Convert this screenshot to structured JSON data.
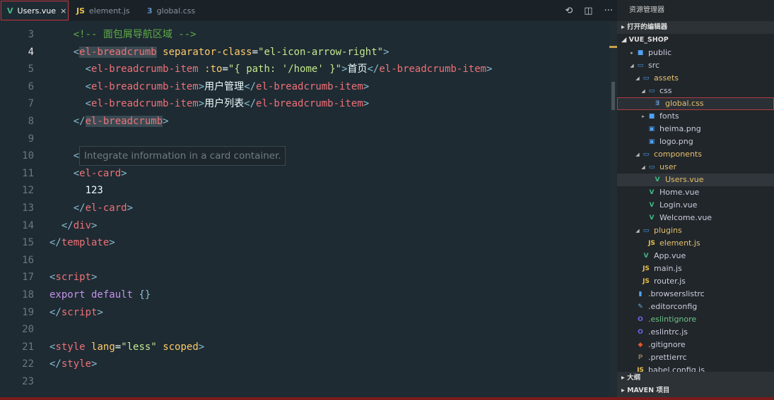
{
  "tabs": [
    {
      "label": "Users.vue",
      "icon": "V",
      "icon_color": "#41b883",
      "active": true
    },
    {
      "label": "element.js",
      "icon": "JS",
      "icon_color": "#e8c04a"
    },
    {
      "label": "global.css",
      "icon": "3",
      "icon_color": "#5d8fc4"
    }
  ],
  "actions": {
    "compare": "⟲",
    "split": "◫",
    "more": "···"
  },
  "editor": {
    "current_line": 4,
    "lines": [
      {
        "n": 3,
        "indent": 4,
        "tokens": [
          [
            "cm",
            "<!-- 面包屑导航区域 -->"
          ]
        ]
      },
      {
        "n": 4,
        "indent": 4,
        "tokens": [
          [
            "p",
            "<"
          ],
          [
            "tag hl",
            "el-breadcrumb"
          ],
          [
            "txt",
            " "
          ],
          [
            "attr",
            "separator-class"
          ],
          [
            "txt",
            "="
          ],
          [
            "str",
            "\"el-icon-arrow-right\""
          ],
          [
            "p",
            ">"
          ]
        ]
      },
      {
        "n": 5,
        "indent": 6,
        "tokens": [
          [
            "p",
            "<"
          ],
          [
            "tag",
            "el-breadcrumb-item"
          ],
          [
            "txt",
            " "
          ],
          [
            "attr",
            ":to"
          ],
          [
            "txt",
            "="
          ],
          [
            "str",
            "\"{ path: '/home' }\""
          ],
          [
            "p",
            ">"
          ],
          [
            "txt",
            "首页"
          ],
          [
            "p",
            "</"
          ],
          [
            "tag",
            "el-breadcrumb-item"
          ],
          [
            "p",
            ">"
          ]
        ]
      },
      {
        "n": 6,
        "indent": 6,
        "tokens": [
          [
            "p",
            "<"
          ],
          [
            "tag",
            "el-breadcrumb-item"
          ],
          [
            "p",
            ">"
          ],
          [
            "txt",
            "用户管理"
          ],
          [
            "p",
            "</"
          ],
          [
            "tag",
            "el-breadcrumb-item"
          ],
          [
            "p",
            ">"
          ]
        ]
      },
      {
        "n": 7,
        "indent": 6,
        "tokens": [
          [
            "p",
            "<"
          ],
          [
            "tag",
            "el-breadcrumb-item"
          ],
          [
            "p",
            ">"
          ],
          [
            "txt",
            "用户列表"
          ],
          [
            "p",
            "</"
          ],
          [
            "tag",
            "el-breadcrumb-item"
          ],
          [
            "p",
            ">"
          ]
        ]
      },
      {
        "n": 8,
        "indent": 4,
        "tokens": [
          [
            "p",
            "</"
          ],
          [
            "tag hl",
            "el-breadcrumb"
          ],
          [
            "p",
            ">"
          ]
        ]
      },
      {
        "n": 9,
        "indent": 0,
        "tokens": []
      },
      {
        "n": 10,
        "indent": 4,
        "tokens": [
          [
            "p",
            "<"
          ]
        ]
      },
      {
        "n": 11,
        "indent": 4,
        "tokens": [
          [
            "p",
            "<"
          ],
          [
            "tag",
            "el-card"
          ],
          [
            "p",
            ">"
          ]
        ]
      },
      {
        "n": 12,
        "indent": 6,
        "tokens": [
          [
            "txt",
            "123"
          ]
        ]
      },
      {
        "n": 13,
        "indent": 4,
        "tokens": [
          [
            "p",
            "</"
          ],
          [
            "tag",
            "el-card"
          ],
          [
            "p",
            ">"
          ]
        ]
      },
      {
        "n": 14,
        "indent": 2,
        "tokens": [
          [
            "p",
            "</"
          ],
          [
            "tag",
            "div"
          ],
          [
            "p",
            ">"
          ]
        ]
      },
      {
        "n": 15,
        "indent": 0,
        "tokens": [
          [
            "p",
            "</"
          ],
          [
            "tag",
            "template"
          ],
          [
            "p",
            ">"
          ]
        ]
      },
      {
        "n": 16,
        "indent": 0,
        "tokens": []
      },
      {
        "n": 17,
        "indent": 0,
        "tokens": [
          [
            "p",
            "<"
          ],
          [
            "tag",
            "script"
          ],
          [
            "p",
            ">"
          ]
        ]
      },
      {
        "n": 18,
        "indent": 0,
        "tokens": [
          [
            "kw",
            "export default"
          ],
          [
            "txt",
            " "
          ],
          [
            "p",
            "{}"
          ]
        ]
      },
      {
        "n": 19,
        "indent": 0,
        "tokens": [
          [
            "p",
            "</"
          ],
          [
            "tag",
            "script"
          ],
          [
            "p",
            ">"
          ]
        ]
      },
      {
        "n": 20,
        "indent": 0,
        "tokens": []
      },
      {
        "n": 21,
        "indent": 0,
        "tokens": [
          [
            "p",
            "<"
          ],
          [
            "tag",
            "style"
          ],
          [
            "txt",
            " "
          ],
          [
            "attr",
            "lang"
          ],
          [
            "txt",
            "="
          ],
          [
            "str",
            "\"less\""
          ],
          [
            "txt",
            " "
          ],
          [
            "attr",
            "scoped"
          ],
          [
            "p",
            ">"
          ]
        ]
      },
      {
        "n": 22,
        "indent": 0,
        "tokens": [
          [
            "p",
            "</"
          ],
          [
            "tag",
            "style"
          ],
          [
            "p",
            ">"
          ]
        ]
      },
      {
        "n": 23,
        "indent": 0,
        "tokens": []
      }
    ],
    "tooltip": "Integrate information in a card container."
  },
  "sidebar": {
    "title": "资源管理器",
    "open_editors": "打开的编辑器",
    "project": "VUE_SHOP",
    "tree": [
      {
        "label": "public",
        "depth": 1,
        "twisty": "closed",
        "icon": "folder",
        "icon_color": "#4fa3f7"
      },
      {
        "label": "src",
        "depth": 1,
        "twisty": "open",
        "icon": "folder-open",
        "icon_color": "#4fa3f7"
      },
      {
        "label": "assets",
        "depth": 2,
        "twisty": "open",
        "icon": "folder-open",
        "icon_color": "#4fa3f7",
        "color": "#e6c06e"
      },
      {
        "label": "css",
        "depth": 3,
        "twisty": "open",
        "icon": "folder-open",
        "icon_color": "#4fa3f7"
      },
      {
        "label": "global.css",
        "depth": 4,
        "icon": "css",
        "icon_color": "#5d8fc4",
        "selected": true,
        "color": "#e6c06e"
      },
      {
        "label": "fonts",
        "depth": 3,
        "twisty": "closed",
        "icon": "folder",
        "icon_color": "#4fa3f7"
      },
      {
        "label": "heima.png",
        "depth": 3,
        "icon": "image",
        "icon_color": "#4fa3f7"
      },
      {
        "label": "logo.png",
        "depth": 3,
        "icon": "image",
        "icon_color": "#4fa3f7"
      },
      {
        "label": "components",
        "depth": 2,
        "twisty": "open",
        "icon": "folder-open",
        "icon_color": "#4fa3f7",
        "color": "#e6c06e"
      },
      {
        "label": "user",
        "depth": 3,
        "twisty": "open",
        "icon": "folder-open",
        "icon_color": "#4fa3f7",
        "color": "#e6c06e"
      },
      {
        "label": "Users.vue",
        "depth": 4,
        "icon": "vue",
        "icon_color": "#41b883",
        "active": true,
        "color": "#e6c06e"
      },
      {
        "label": "Home.vue",
        "depth": 3,
        "icon": "vue",
        "icon_color": "#41b883"
      },
      {
        "label": "Login.vue",
        "depth": 3,
        "icon": "vue",
        "icon_color": "#41b883"
      },
      {
        "label": "Welcome.vue",
        "depth": 3,
        "icon": "vue",
        "icon_color": "#41b883"
      },
      {
        "label": "plugins",
        "depth": 2,
        "twisty": "open",
        "icon": "folder-open",
        "icon_color": "#4fa3f7",
        "color": "#e6c06e"
      },
      {
        "label": "element.js",
        "depth": 3,
        "icon": "js",
        "icon_color": "#e8c04a",
        "color": "#e6c06e"
      },
      {
        "label": "App.vue",
        "depth": 2,
        "icon": "vue",
        "icon_color": "#41b883"
      },
      {
        "label": "main.js",
        "depth": 2,
        "icon": "js",
        "icon_color": "#e8c04a"
      },
      {
        "label": "router.js",
        "depth": 2,
        "icon": "js",
        "icon_color": "#e8c04a"
      },
      {
        "label": ".browserslistrc",
        "depth": 1,
        "icon": "file",
        "icon_color": "#4fa3f7"
      },
      {
        "label": ".editorconfig",
        "depth": 1,
        "icon": "editorconfig",
        "icon_color": "#6ab0d6"
      },
      {
        "label": ".eslintignore",
        "depth": 1,
        "icon": "eslint",
        "icon_color": "#6a66f0",
        "color": "#6fc28a"
      },
      {
        "label": ".eslintrc.js",
        "depth": 1,
        "icon": "eslint",
        "icon_color": "#6a66f0"
      },
      {
        "label": ".gitignore",
        "depth": 1,
        "icon": "git",
        "icon_color": "#e2572b"
      },
      {
        "label": ".prettierrc",
        "depth": 1,
        "icon": "prettier",
        "icon_color": "#8a7b5a"
      },
      {
        "label": "babel.config.js",
        "depth": 1,
        "icon": "js",
        "icon_color": "#e8c04a"
      }
    ],
    "outline": "大纲",
    "maven": "MAVEN 项目"
  }
}
